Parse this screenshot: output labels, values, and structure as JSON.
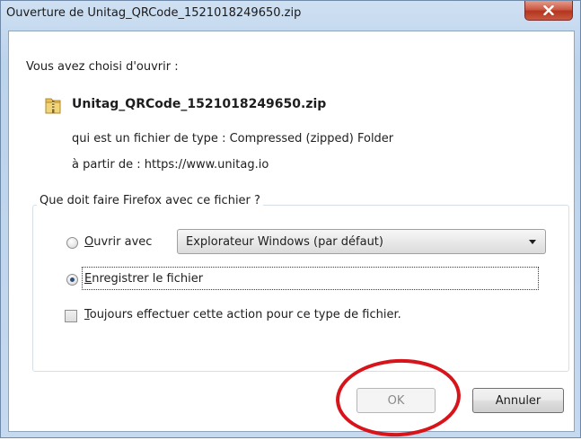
{
  "window": {
    "title": "Ouverture de Unitag_QRCode_1521018249650.zip"
  },
  "dialog": {
    "intro": "Vous avez choisi d'ouvrir :",
    "file_name": "Unitag_QRCode_1521018249650.zip",
    "file_type_line": "qui est un fichier de type : Compressed (zipped) Folder",
    "from_line": "à partir de : https://www.unitag.io",
    "question": "Que doit faire Firefox avec ce fichier ?",
    "open_with": {
      "label_accel": "O",
      "label_rest": "uvrir avec",
      "selected": false,
      "dropdown_value": "Explorateur Windows (par défaut)"
    },
    "save_file": {
      "label_accel": "E",
      "label_rest": "nregistrer le fichier",
      "selected": true
    },
    "always": {
      "label_accel": "T",
      "label_rest": "oujours effectuer cette action pour ce type de fichier.",
      "checked": false
    },
    "ok_label": "OK",
    "cancel_label": "Annuler"
  },
  "colors": {
    "annotation": "#d8141b",
    "title_close": "#c9593f"
  }
}
